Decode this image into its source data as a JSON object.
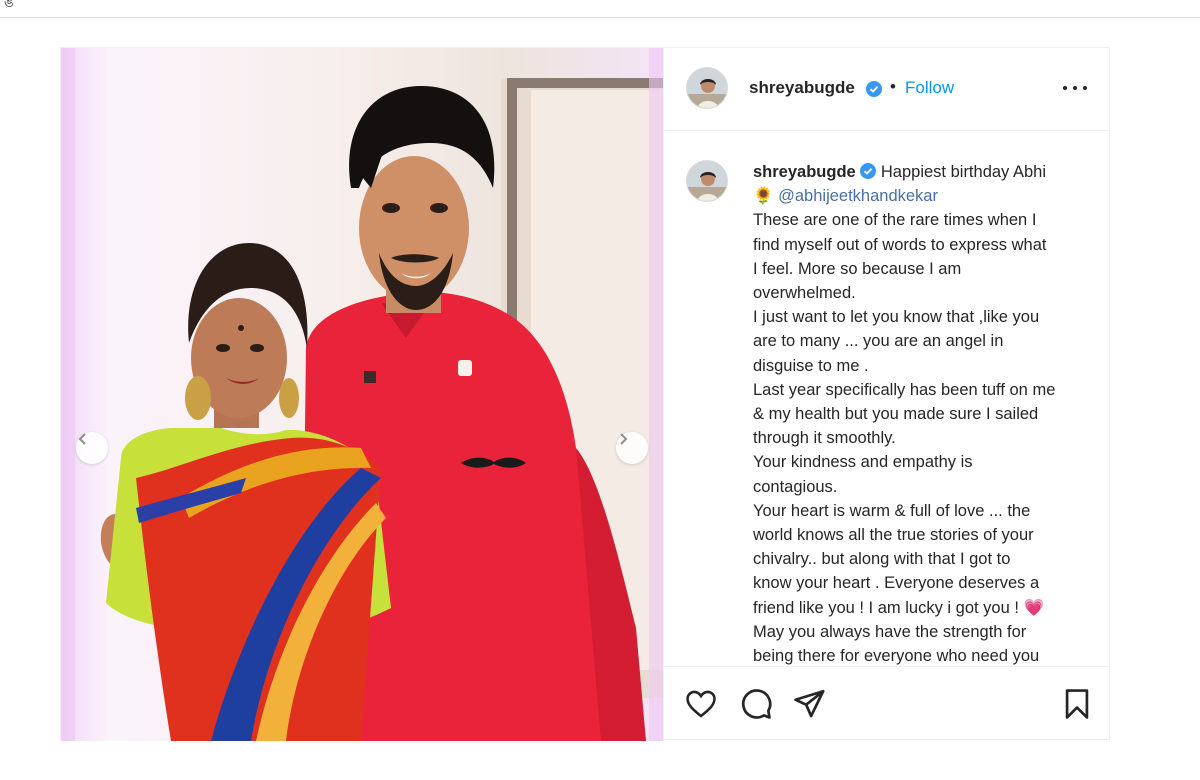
{
  "window": {
    "top_glyph": "ঙ"
  },
  "post": {
    "author": {
      "username": "shreyabugde",
      "verified": true
    },
    "header": {
      "separator": "•",
      "follow_label": "Follow"
    },
    "caption": {
      "username": "shreyabugde",
      "lines": [
        "Happiest birthday Abhi",
        "🌻 @abhijeetkhandkekar",
        "These are one of the rare times when I",
        "find myself out of words to express what",
        "I feel. More so because I am",
        "overwhelmed.",
        "I just want to let you know that ,like you",
        "are to many ... you are an angel in",
        "disguise to me .",
        "Last year specifically has been tuff on me",
        "& my health but you made sure I sailed",
        "through it smoothly.",
        "Your kindness and empathy is",
        "contagious.",
        "Your heart is warm & full of love ... the",
        "world knows all the true stories of your",
        "chivalry.. but along with that I got to",
        "know your heart . Everyone deserves a",
        "friend like you ! I am lucky i got you ! 💗",
        "May you always have the strength for",
        "being there for everyone who need you"
      ]
    },
    "actions": [
      "like-icon",
      "comment-icon",
      "share-icon",
      "save-icon"
    ],
    "carousel": {
      "prev": "chevron-left-icon",
      "next": "chevron-right-icon"
    }
  },
  "colors": {
    "follow": "#0095f6",
    "verified": "#3897f0",
    "mention": "#00376b",
    "saree_red": "#e0301e",
    "blouse_green": "#c8e03a",
    "kurta_red": "#e9243a"
  }
}
